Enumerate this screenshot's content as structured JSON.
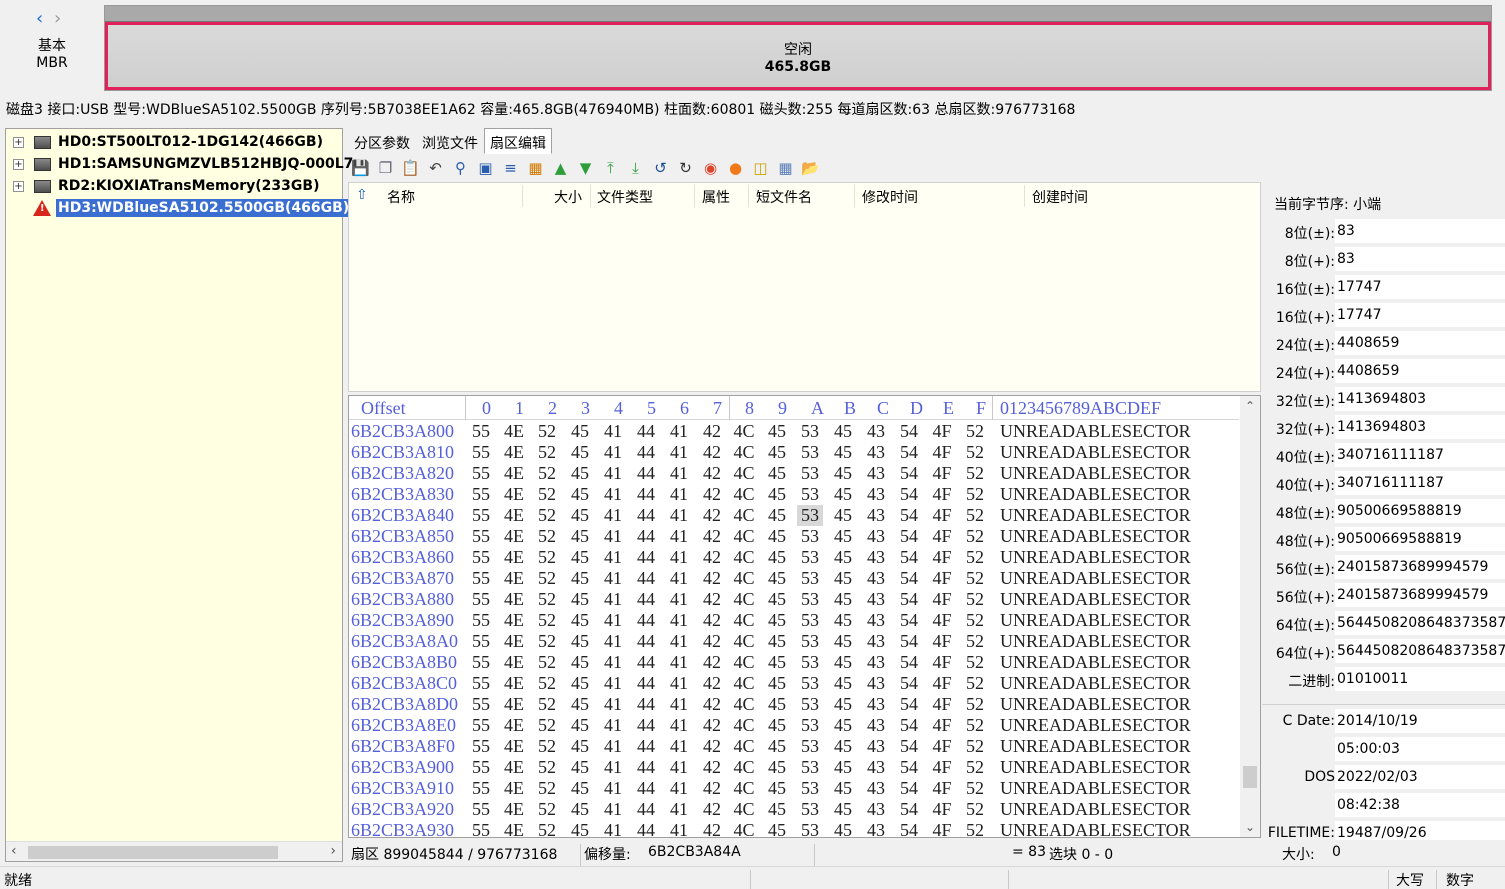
{
  "nav": {
    "back_icon": "‹",
    "forward_icon": "›",
    "disk_type_line1": "基本",
    "disk_type_line2": "MBR"
  },
  "partition": {
    "label": "空闲",
    "size": "465.8GB",
    "highlight_color": "#e0215b"
  },
  "disk_info": "磁盘3 接口:USB  型号:WDBlueSA5102.5500GB  序列号:5B7038EE1A62  容量:465.8GB(476940MB)  柱面数:60801  磁头数:255  每道扇区数:63  总扇区数:976773168",
  "tree": {
    "items": [
      {
        "label": "HD0:ST500LT012-1DG142(466GB)",
        "icon": "drive-icon",
        "selected": false
      },
      {
        "label": "HD1:SAMSUNGMZVLB512HBJQ-000L7",
        "icon": "drive-icon",
        "selected": false
      },
      {
        "label": "RD2:KIOXIATransMemory(233GB)",
        "icon": "drive-icon",
        "selected": false
      },
      {
        "label": "HD3:WDBlueSA5102.5500GB(466GB)",
        "icon": "warning-icon",
        "selected": true
      }
    ]
  },
  "tabs": [
    {
      "label": "分区参数",
      "active": false
    },
    {
      "label": "浏览文件",
      "active": false
    },
    {
      "label": "扇区编辑",
      "active": true
    }
  ],
  "file_list": {
    "columns": [
      "名称",
      "大小",
      "文件类型",
      "属性",
      "短文件名",
      "修改时间",
      "创建时间"
    ]
  },
  "hex": {
    "header_offset": "Offset",
    "header_columns": [
      "0",
      "1",
      "2",
      "3",
      "4",
      "5",
      "6",
      "7",
      "8",
      "9",
      "A",
      "B",
      "C",
      "D",
      "E",
      "F"
    ],
    "header_ascii": "0123456789ABCDEF",
    "row_bytes": [
      "55",
      "4E",
      "52",
      "45",
      "41",
      "44",
      "41",
      "42",
      "4C",
      "45",
      "53",
      "45",
      "43",
      "54",
      "4F",
      "52"
    ],
    "row_ascii": "UNREADABLESECTOR",
    "offsets": [
      "6B2CB3A800",
      "6B2CB3A810",
      "6B2CB3A820",
      "6B2CB3A830",
      "6B2CB3A840",
      "6B2CB3A850",
      "6B2CB3A860",
      "6B2CB3A870",
      "6B2CB3A880",
      "6B2CB3A890",
      "6B2CB3A8A0",
      "6B2CB3A8B0",
      "6B2CB3A8C0",
      "6B2CB3A8D0",
      "6B2CB3A8E0",
      "6B2CB3A8F0",
      "6B2CB3A900",
      "6B2CB3A910",
      "6B2CB3A920",
      "6B2CB3A930"
    ],
    "selected_row": 4,
    "selected_col": 10
  },
  "hex_status": {
    "sector": "扇区 899045844 / 976773168",
    "offset_label": "偏移量:",
    "offset_value": "6B2CB3A84A",
    "value": "= 83",
    "selection": "选块 0 - 0"
  },
  "inspector": {
    "endian": "当前字节序:  小端",
    "rows": [
      {
        "label": "8位(±):",
        "value": "83"
      },
      {
        "label": "8位(+):",
        "value": "83"
      },
      {
        "label": "16位(±):",
        "value": "17747"
      },
      {
        "label": "16位(+):",
        "value": "17747"
      },
      {
        "label": "24位(±):",
        "value": "4408659"
      },
      {
        "label": "24位(+):",
        "value": "4408659"
      },
      {
        "label": "32位(±):",
        "value": "1413694803"
      },
      {
        "label": "32位(+):",
        "value": "1413694803"
      },
      {
        "label": "40位(±):",
        "value": "340716111187"
      },
      {
        "label": "40位(+):",
        "value": "340716111187"
      },
      {
        "label": "48位(±):",
        "value": "90500669588819"
      },
      {
        "label": "48位(+):",
        "value": "90500669588819"
      },
      {
        "label": "56位(±):",
        "value": "24015873689994579"
      },
      {
        "label": "56位(+):",
        "value": "24015873689994579"
      },
      {
        "label": "64位(±):",
        "value": "5644508208648373587"
      },
      {
        "label": "64位(+):",
        "value": "5644508208648373587"
      },
      {
        "label": "二进制:",
        "value": "01010011"
      }
    ],
    "dates": [
      {
        "label": "C Date:",
        "value": "2014/10/19"
      },
      {
        "label": "",
        "value": "05:00:03"
      },
      {
        "label": "DOS",
        "value": "2022/02/03"
      },
      {
        "label": "",
        "value": "08:42:38"
      },
      {
        "label": "FILETIME:",
        "value": "19487/09/26"
      }
    ],
    "size_label": "大小:",
    "size_value": "0"
  },
  "statusbar": {
    "ready": "就绪",
    "caps": "大写",
    "num": "数字"
  }
}
